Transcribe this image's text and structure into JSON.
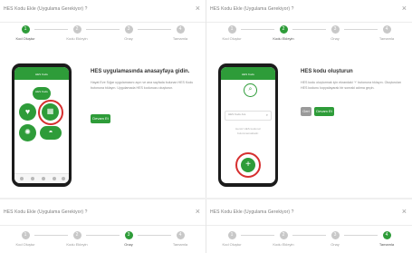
{
  "panels": [
    {
      "title": "HES Kodu Ekle (Uygulama Gerekiyor) ?",
      "steps": [
        "Kod Oluştur",
        "Kodu Ekleyin",
        "Onay",
        "Tamamla"
      ],
      "active_step": 1,
      "app_title": "HES Kodu",
      "heading": "HES uygulamasında anasayfaya gidin.",
      "body": "Hayat Eve Sığar uygulamasını açın ve ana sayfada bulunan HES Kodu butonuna tıklayın. Uygulamada HES kodunuzu oluşturun.",
      "button": "Devam Et",
      "tile_label": "HES Kodu"
    },
    {
      "title": "HES Kodu Ekle (Uygulama Gerekiyor) ?",
      "steps": [
        "Kod Oluştur",
        "Kodu Ekleyin",
        "Onay",
        "Tamamla"
      ],
      "active_step": 2,
      "app_title": "HES Kodu",
      "heading": "HES kodu oluşturun",
      "body": "HES kodu oluşturmak için ekrandaki '+' butonuna tıklayın. Oluşturulan HES kodunu kopyalayarak bir sonraki adıma geçin.",
      "search_placeholder": "HES Kodu Ara",
      "empty_text": "Henüz HES kodunuz bulunmamaktadır.",
      "button_back": "Geri",
      "button_next": "Devam Et"
    },
    {
      "title": "HES Kodu Ekle (Uygulama Gerekiyor) ?",
      "steps": [
        "Kod Oluştur",
        "Kodu Ekleyin",
        "Onay",
        "Tamamla"
      ],
      "active_step": 3
    },
    {
      "title": "HES Kodu Ekle (Uygulama Gerekiyor) ?",
      "steps": [
        "Kod Oluştur",
        "Kodu Ekleyin",
        "Onay",
        "Tamamla"
      ],
      "active_step": 4
    }
  ],
  "icons": {
    "close": "close-icon",
    "heart": "heart-icon",
    "qr": "qr-code-icon",
    "virus": "virus-icon",
    "mask": "mask-icon",
    "plus": "plus-icon",
    "search": "search-icon"
  },
  "colors": {
    "accent": "#2e9c39",
    "highlight": "#d62f2f"
  }
}
